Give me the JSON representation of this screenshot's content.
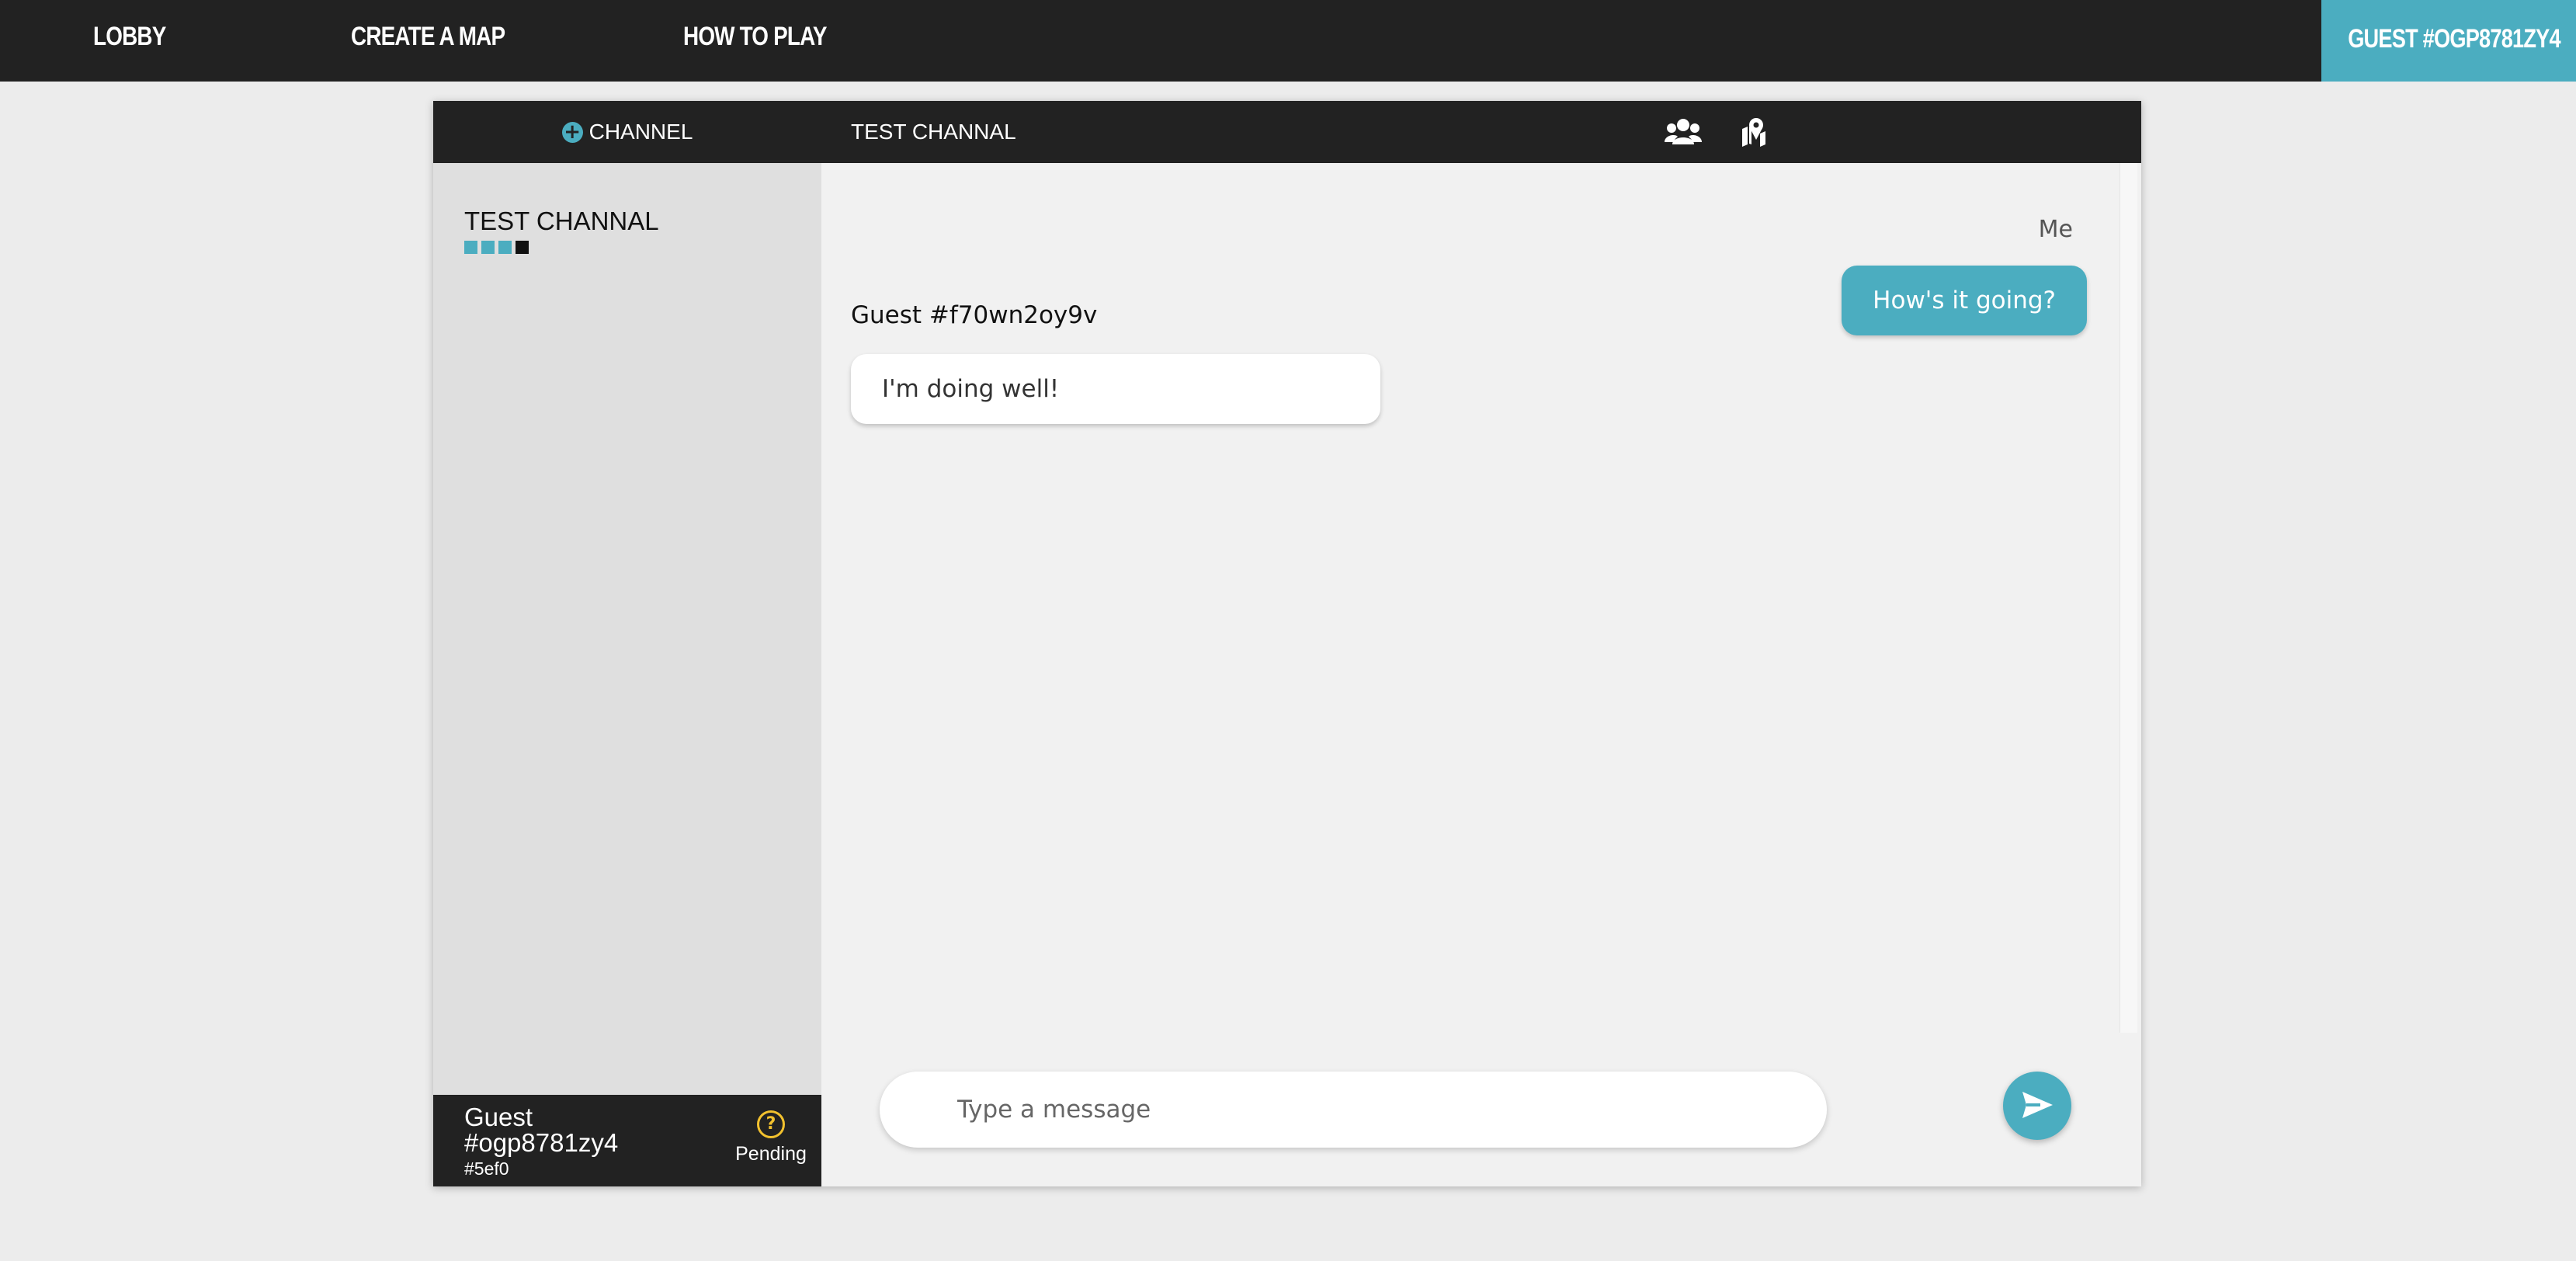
{
  "nav": {
    "lobby": "LOBBY",
    "create_map": "CREATE A MAP",
    "how_to_play": "HOW TO PLAY",
    "user": "GUEST #OGP8781ZY4"
  },
  "sidebar": {
    "add_channel_label": "CHANNEL",
    "add_channel_icon": "plus-circle-icon",
    "channels": [
      {
        "name": "TEST CHANNAL",
        "dots": [
          "#4badc0",
          "#4badc0",
          "#4badc0",
          "#111111"
        ]
      }
    ],
    "user": {
      "name": "Guest #ogp8781zy4",
      "tag": "#5ef0",
      "status": "Pending",
      "status_icon": "question-circle-icon"
    }
  },
  "chat": {
    "title": "TEST CHANNAL",
    "header_icons": [
      "users-icon",
      "map-icon"
    ],
    "messages": [
      {
        "sender": "Me",
        "text": "How's it going?",
        "mine": true
      },
      {
        "sender": "Guest #f70wn2oy9v",
        "text": "I'm doing well!",
        "mine": false
      }
    ],
    "composer": {
      "placeholder": "Type a message",
      "value": ""
    },
    "send_icon": "send-icon"
  },
  "colors": {
    "accent": "#4badc0",
    "bar": "#222222",
    "pending": "#f2c12e"
  }
}
